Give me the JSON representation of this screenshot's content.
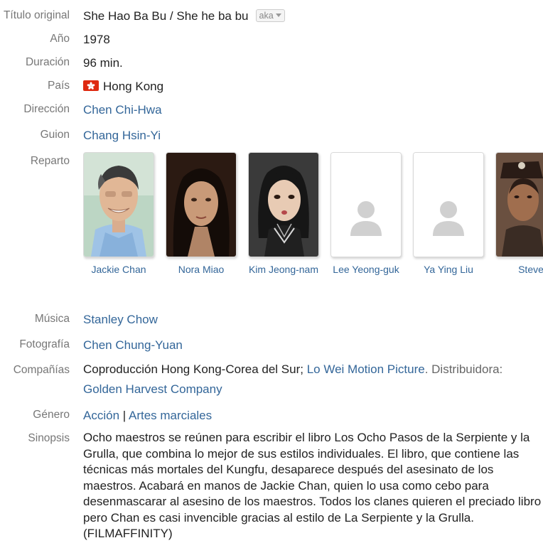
{
  "labels": {
    "original_title": "Título original",
    "year": "Año",
    "duration": "Duración",
    "country": "País",
    "direction": "Dirección",
    "script": "Guion",
    "cast": "Reparto",
    "music": "Música",
    "photography": "Fotografía",
    "companies": "Compañías",
    "genre": "Género",
    "synopsis": "Sinopsis"
  },
  "original_title": "She Hao Ba Bu / She he ba bu",
  "aka_label": "aka",
  "year": "1978",
  "duration": "96 min.",
  "country": "Hong Kong",
  "director": "Chen Chi-Hwa",
  "script": "Chang Hsin-Yi",
  "cast": [
    {
      "name": "Jackie Chan"
    },
    {
      "name": "Nora Miao"
    },
    {
      "name": "Kim Jeong-nam"
    },
    {
      "name": "Lee Yeong-guk"
    },
    {
      "name": "Ya Ying Liu"
    },
    {
      "name": "Steve"
    }
  ],
  "music": "Stanley Chow",
  "photography": "Chen Chung-Yuan",
  "companies": {
    "prefix": "Coproducción Hong Kong-Corea del Sur;",
    "producer": "Lo Wei Motion Picture",
    "distributor_label": ". Distribuidora:",
    "distributor": "Golden Harvest Company"
  },
  "genres": [
    "Acción",
    "Artes marciales"
  ],
  "genre_separator": "|",
  "synopsis": "Ocho maestros se reúnen para escribir el libro Los Ocho Pasos de la Serpiente y la Grulla, que combina lo mejor de sus estilos individuales. El libro, que contiene las técnicas más mortales del Kungfu, desaparece después del asesinato de los maestros. Acabará en manos de Jackie Chan, quien lo usa como cebo para desenmascarar al asesino de los maestros. Todos los clanes quieren el preciado libro pero Chan es casi invencible gracias al estilo de La Serpiente y la Grulla. (FILMAFFINITY)",
  "colors": {
    "link": "#336699",
    "label": "#777777",
    "flag": "#de2910"
  },
  "icons": {
    "country_flag": "hong-kong-flag-icon",
    "aka_dropdown": "chevron-down-icon",
    "no_photo": "person-placeholder-icon"
  }
}
